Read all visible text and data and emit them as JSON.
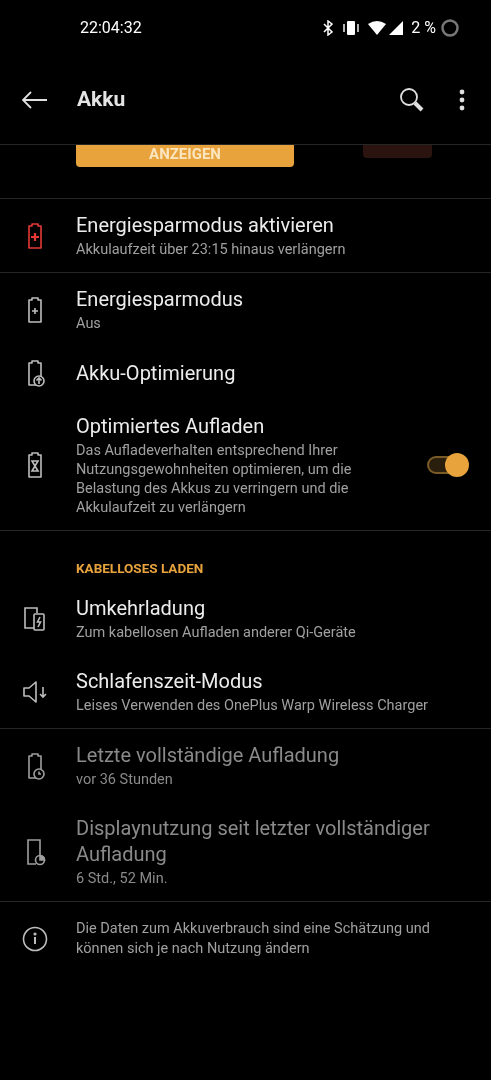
{
  "status_bar": {
    "time": "22:04:32",
    "battery": "2 %"
  },
  "header": {
    "title": "Akku"
  },
  "banner": {
    "button": "ANZEIGEN"
  },
  "sections": [
    {
      "items": [
        {
          "kind": "link",
          "title": "Energiesparmodus aktivieren",
          "subtitle": "Akkulaufzeit über 23:15 hinaus verlängern",
          "disabled": false
        }
      ]
    },
    {
      "items": [
        {
          "kind": "link",
          "title": "Energiesparmodus",
          "subtitle": "Aus",
          "disabled": false
        },
        {
          "kind": "link",
          "title": "Akku-Optimierung",
          "disabled": false
        },
        {
          "kind": "toggle",
          "title": "Optimiertes Aufladen",
          "subtitle": "Das Aufladeverhalten entsprechend Ihrer Nutzungsgewohnheiten optimieren, um die Belastung des Akkus zu verringern und die Akkulaufzeit zu verlängern",
          "disabled": false,
          "on": true
        }
      ]
    },
    {
      "header": "KABELLOSES LADEN",
      "items": [
        {
          "kind": "link",
          "title": "Umkehrladung",
          "subtitle": "Zum kabellosen Aufladen anderer Qi-Geräte",
          "disabled": false
        },
        {
          "kind": "link",
          "title": "Schlafenszeit-Modus",
          "subtitle": "Leises Verwenden des OnePlus Warp Wireless Charger",
          "disabled": false
        }
      ]
    },
    {
      "items": [
        {
          "kind": "link",
          "title": "Letzte vollständige Aufladung",
          "subtitle": "vor 36 Stunden",
          "disabled": true
        },
        {
          "kind": "link",
          "title": "Displaynutzung seit letzter vollständiger Aufladung",
          "subtitle": "6 Std., 52 Min.",
          "disabled": true
        }
      ]
    }
  ],
  "footer": {
    "text": "Die Daten zum Akkuverbrauch sind eine Schätzung und können sich je nach Nutzung ändern"
  }
}
